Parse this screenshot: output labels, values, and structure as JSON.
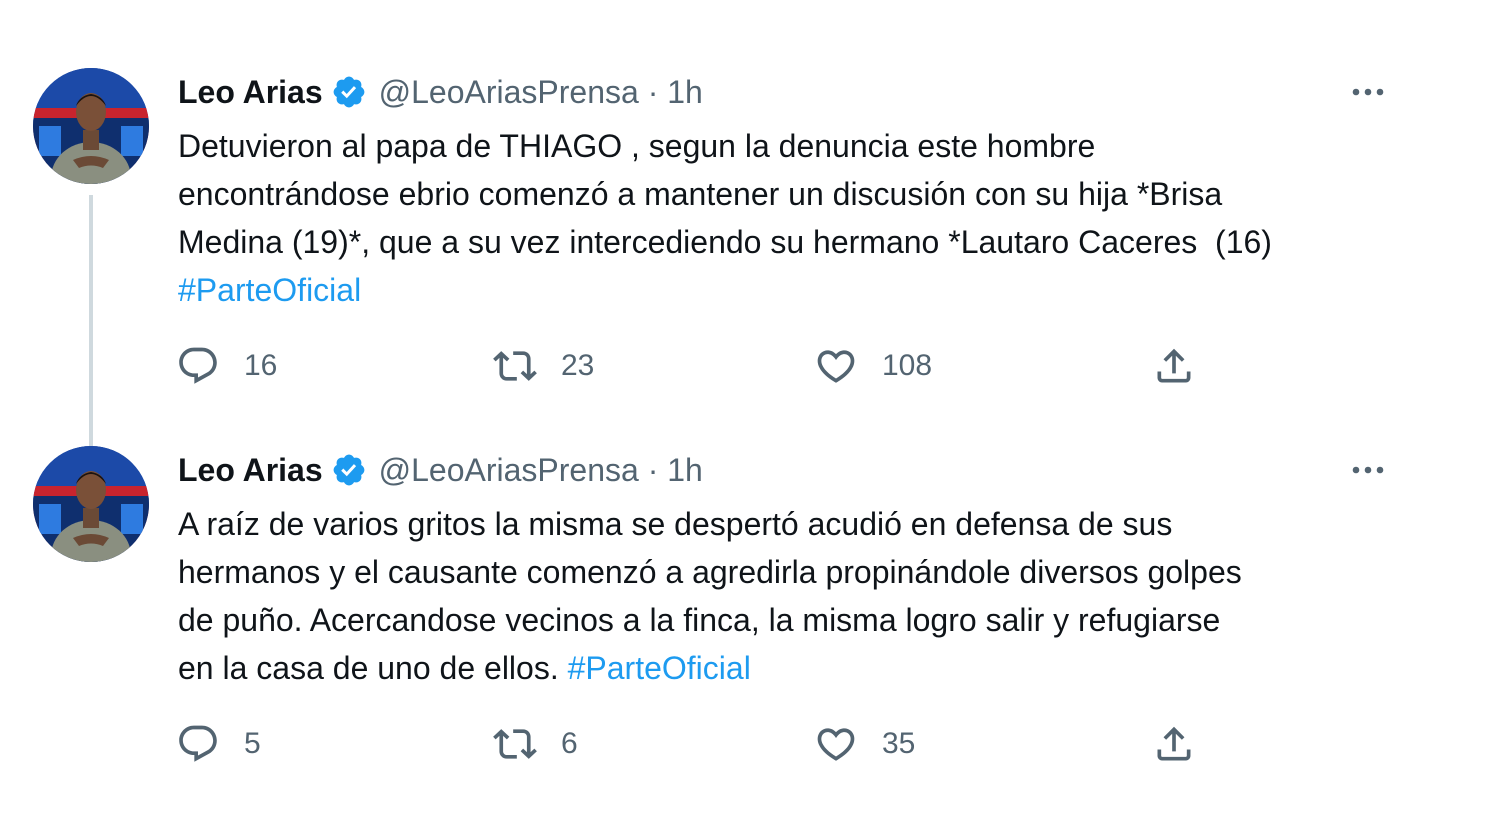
{
  "tweets": [
    {
      "author": {
        "name": "Leo Arias",
        "meta": "@LeoAriasPrensa · 1h"
      },
      "text_parts": [
        "Detuvieron al papa de THIAGO , segun la denuncia este hombre\nencontrándose ebrio comenzó a mantener un discusión con su hija *Brisa\nMedina (19)*, que a su vez intercediendo su hermano *Lautaro Caceres  (16)\n"
      ],
      "hashtag": "#ParteOficial",
      "replies": "16",
      "retweets": "23",
      "likes": "108"
    },
    {
      "author": {
        "name": "Leo Arias",
        "meta": "@LeoAriasPrensa · 1h"
      },
      "text_parts": [
        "A raíz de varios gritos la misma se despertó acudió en defensa de sus\nhermanos y el causante comenzó a agredirla propinándole diversos golpes\nde puño. Acercandose vecinos a la finca, la misma logro salir y refugiarse\nen la casa de uno de ellos. "
      ],
      "hashtag": "#ParteOficial",
      "replies": "5",
      "retweets": "6",
      "likes": "35"
    }
  ],
  "icons": {
    "verified": "verified-badge-icon",
    "more": "more-options-icon",
    "reply": "reply-icon",
    "retweet": "retweet-icon",
    "like": "heart-icon",
    "share": "share-icon"
  },
  "colors": {
    "text": "#0f1419",
    "secondary": "#536471",
    "accent": "#1d9bf0",
    "thread_line": "#cfd9de"
  }
}
